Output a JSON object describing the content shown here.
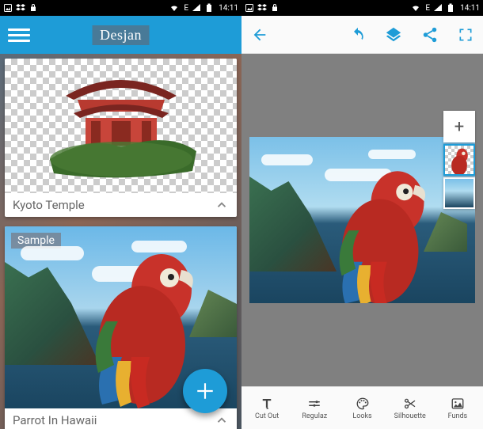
{
  "status": {
    "time": "14:11",
    "network": "E",
    "signal_level": 3,
    "battery": "full"
  },
  "left": {
    "app_title": "Desjan",
    "cards": [
      {
        "caption": "Kyoto Temple"
      },
      {
        "caption": "Parrot In Hawaii",
        "badge": "Sample"
      }
    ],
    "fab_icon": "plus-icon"
  },
  "right": {
    "toolbar_actions": {
      "back": "back-icon",
      "undo": "undo-icon",
      "layers": "layers-icon",
      "share": "share-icon",
      "fullscreen": "fullscreen-icon"
    },
    "layer_panel": {
      "add": "+",
      "items": [
        "parrot-layer",
        "background-layer"
      ]
    },
    "tools": [
      {
        "label": "Cut Out",
        "icon": "text-format-icon"
      },
      {
        "label": "Regulaz",
        "icon": "sliders-icon"
      },
      {
        "label": "Looks",
        "icon": "palette-icon"
      },
      {
        "label": "Silhouette",
        "icon": "scissors-icon"
      },
      {
        "label": "Funds",
        "icon": "image-icon"
      }
    ]
  },
  "colors": {
    "accent": "#1e9cd7",
    "toolbar_bg": "#fafafa",
    "canvas_bg": "#808080"
  }
}
